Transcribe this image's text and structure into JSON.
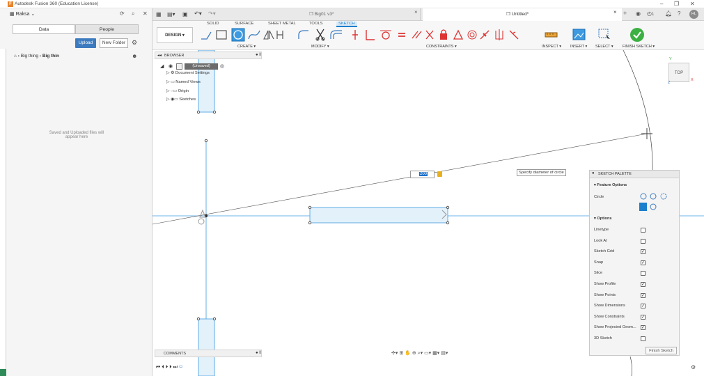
{
  "window": {
    "title": "Autodesk Fusion 360 (Education License)",
    "controls": [
      "–",
      "❐",
      "✕"
    ]
  },
  "left": {
    "team": "Raksa",
    "tabs": [
      "Data",
      "People"
    ],
    "upload": "Upload",
    "new_folder": "New Folder",
    "breadcrumb": [
      "Big thing",
      "Big thin"
    ],
    "empty_msg_1": "Saved and Uploaded files will",
    "empty_msg_2": "appear here"
  },
  "tabs": {
    "doc1": "Big01 v3*",
    "doc2": "Untitled*",
    "badge": "1"
  },
  "toolbar": {
    "workspace_tabs": [
      "SOLID",
      "SURFACE",
      "SHEET METAL",
      "TOOLS",
      "SKETCH"
    ],
    "design": "DESIGN ▾",
    "groups": [
      "CREATE ▾",
      "MODIFY ▾",
      "CONSTRAINTS ▾",
      "INSPECT ▾",
      "INSERT ▾",
      "SELECT ▾",
      "FINISH SKETCH ▾"
    ]
  },
  "browser": {
    "title": "BROWSER",
    "root": "(Unsaved)",
    "items": [
      "Document Settings",
      "Named Views",
      "Origin",
      "Sketches"
    ]
  },
  "canvas": {
    "dim_value": "200",
    "tooltip": "Specify diameter of circle",
    "viewcube": "TOP",
    "axis_x": "X",
    "axis_y": "Y",
    "axis_z": "Z"
  },
  "palette": {
    "title": "SKETCH PALETTE",
    "feature_options": "Feature Options",
    "circle_label": "Circle",
    "options": "Options",
    "rows": [
      {
        "label": "Linetype",
        "checked": false
      },
      {
        "label": "Look At",
        "checked": false
      },
      {
        "label": "Sketch Grid",
        "checked": true
      },
      {
        "label": "Snap",
        "checked": true
      },
      {
        "label": "Slice",
        "checked": false
      },
      {
        "label": "Show Profile",
        "checked": true
      },
      {
        "label": "Show Points",
        "checked": true
      },
      {
        "label": "Show Dimensions",
        "checked": true
      },
      {
        "label": "Show Constraints",
        "checked": true
      },
      {
        "label": "Show Projected Geom...",
        "checked": true
      },
      {
        "label": "3D Sketch",
        "checked": false
      }
    ],
    "finish": "Finish Sketch"
  },
  "comments": "COMMENTS"
}
